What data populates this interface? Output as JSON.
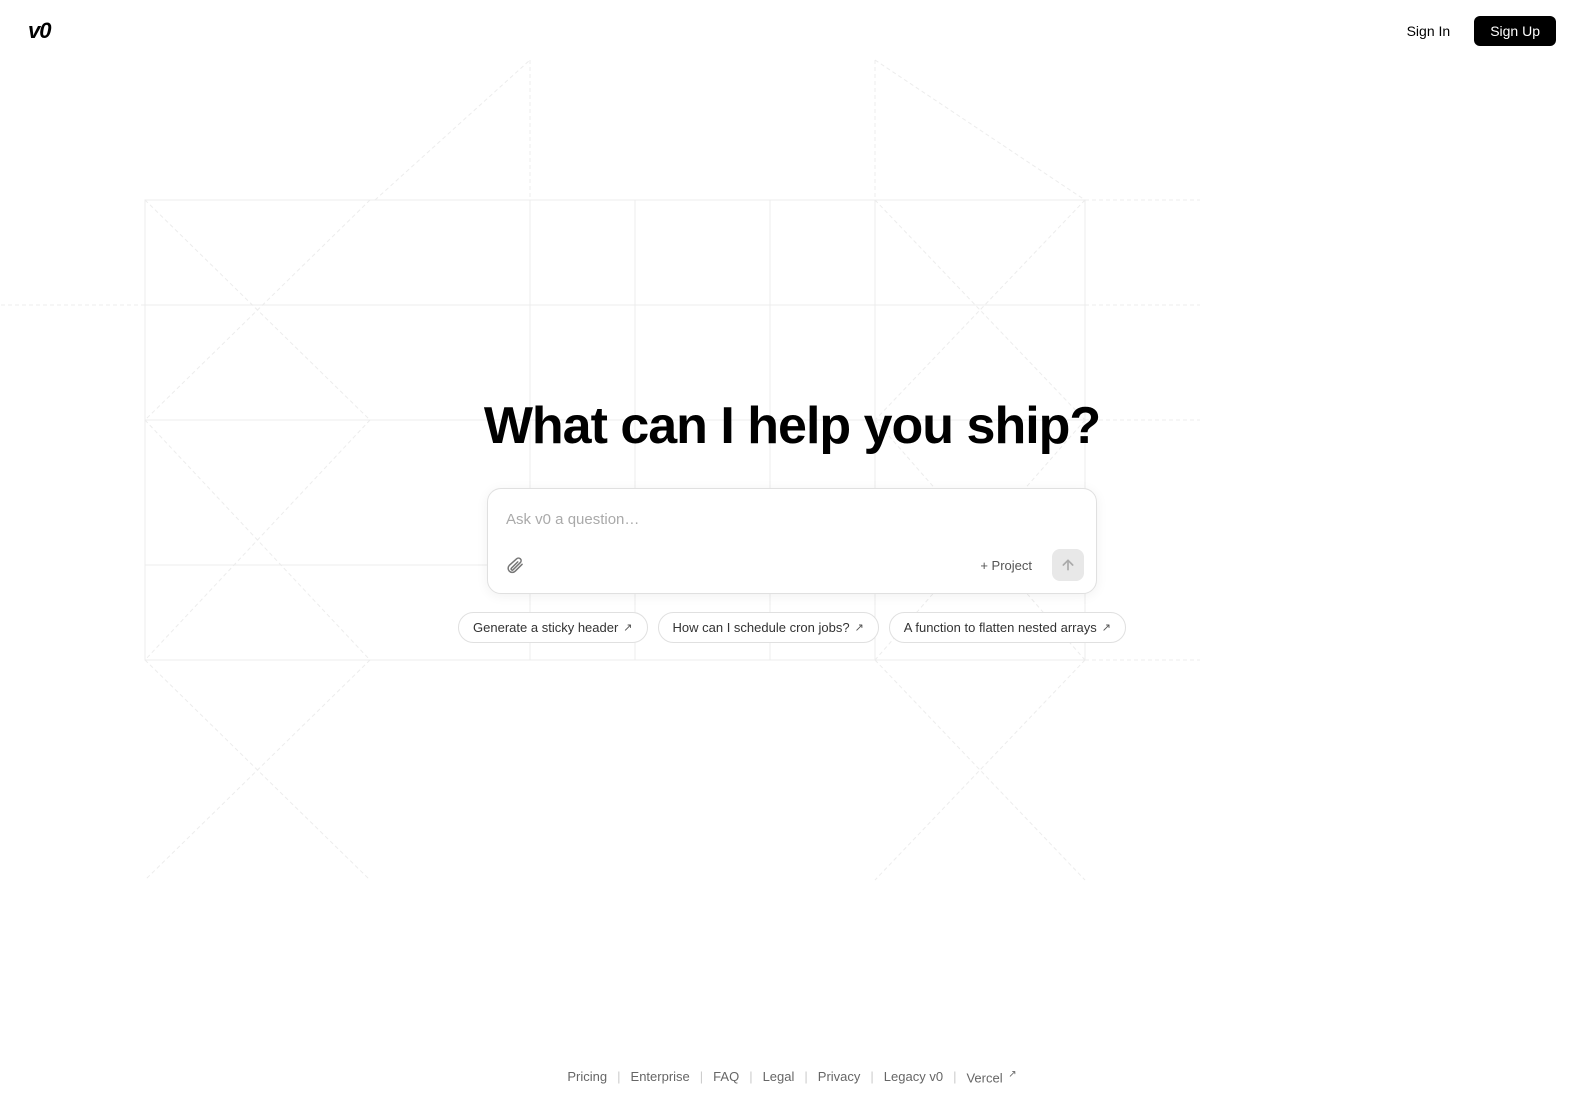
{
  "header": {
    "logo": "v0",
    "sign_in_label": "Sign In",
    "sign_up_label": "Sign Up"
  },
  "hero": {
    "title": "What can I help you ship?"
  },
  "search": {
    "placeholder": "Ask v0 a question…",
    "attach_icon": "paperclip-icon",
    "project_label": "+ Project",
    "submit_icon": "arrow-up-icon"
  },
  "suggestions": [
    {
      "label": "Generate a sticky header",
      "arrow": "↗"
    },
    {
      "label": "How can I schedule cron jobs?",
      "arrow": "↗"
    },
    {
      "label": "A function to flatten nested arrays",
      "arrow": "↗"
    }
  ],
  "footer": {
    "links": [
      {
        "label": "Pricing",
        "external": false
      },
      {
        "label": "Enterprise",
        "external": false
      },
      {
        "label": "FAQ",
        "external": false
      },
      {
        "label": "Legal",
        "external": false
      },
      {
        "label": "Privacy",
        "external": false
      },
      {
        "label": "Legacy v0",
        "external": false
      },
      {
        "label": "Vercel",
        "external": true
      }
    ]
  },
  "colors": {
    "accent": "#000000",
    "background": "#ffffff",
    "border": "#e0e0e0",
    "text_muted": "#666666"
  }
}
